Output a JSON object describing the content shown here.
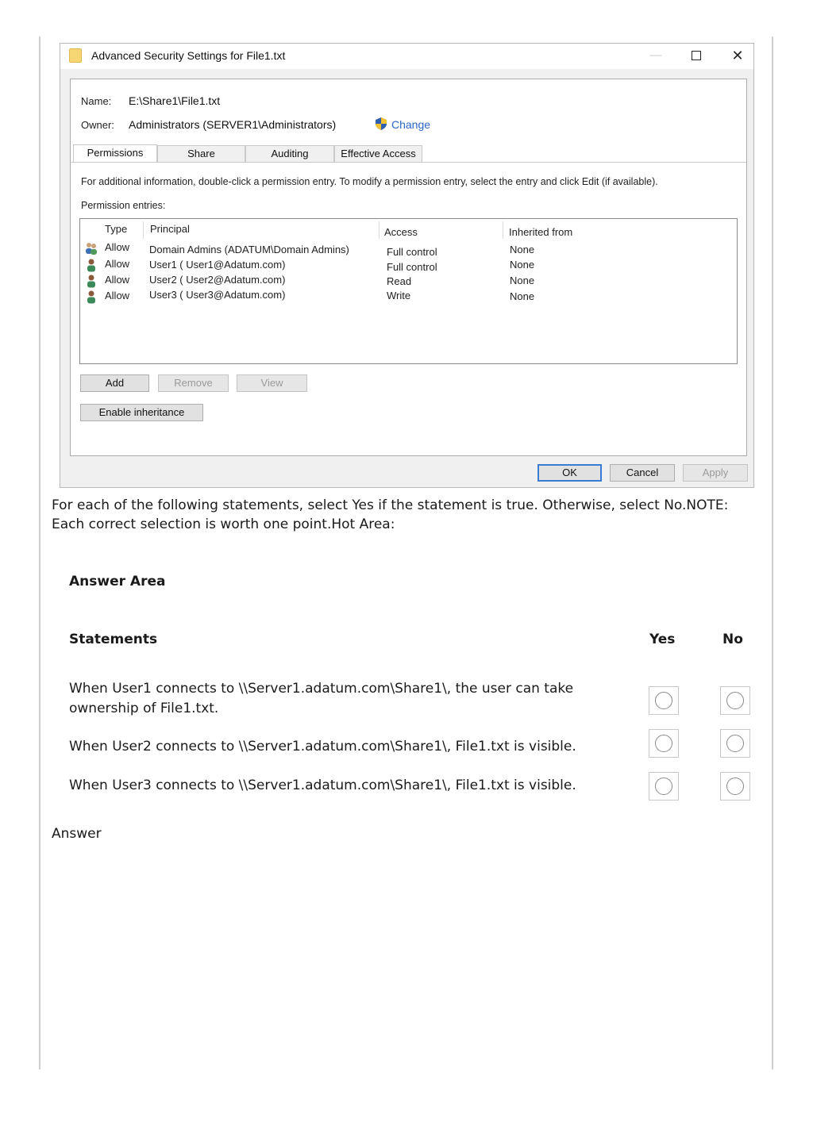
{
  "dialog": {
    "title": "Advanced Security Settings for File1.txt",
    "window_controls": {
      "minimize": "—",
      "close": "✕"
    },
    "name_label": "Name:",
    "name_value": "E:\\Share1\\File1.txt",
    "owner_label": "Owner:",
    "owner_value": "Administrators (SERVER1\\Administrators)",
    "change_link": "Change",
    "tabs": [
      {
        "label": "Permissions",
        "active": true
      },
      {
        "label": "Share",
        "active": false
      },
      {
        "label": "Auditing",
        "active": false
      },
      {
        "label": "Effective Access",
        "active": false
      }
    ],
    "info_text": "For additional information, double-click a permission entry. To modify a permission entry, select the entry and click Edit (if available).",
    "permission_entries_label": "Permission entries:",
    "columns": [
      "Type",
      "Principal",
      "Access",
      "Inherited from"
    ],
    "entries": [
      {
        "type": "Allow",
        "principal": "Domain Admins (ADATUM\\Domain Admins)",
        "access": "Full control",
        "inherited": "None",
        "icon": "group-icon"
      },
      {
        "type": "Allow",
        "principal": "User1 ( User1@Adatum.com)",
        "access": "Full control",
        "inherited": "None",
        "icon": "user-icon"
      },
      {
        "type": "Allow",
        "principal": "User2 ( User2@Adatum.com)",
        "access": "Read",
        "inherited": "None",
        "icon": "user-icon"
      },
      {
        "type": "Allow",
        "principal": "User3 ( User3@Adatum.com)",
        "access": "Write",
        "inherited": "None",
        "icon": "user-icon"
      }
    ],
    "buttons": {
      "add": "Add",
      "remove": "Remove",
      "view": "View",
      "enable_inheritance": "Enable inheritance",
      "ok": "OK",
      "cancel": "Cancel",
      "apply": "Apply"
    },
    "colors": {
      "link": "#2a66c9",
      "accent_border": "#3a7bd5"
    }
  },
  "question": {
    "text": "For each of the following statements, select Yes if the statement is true. Otherwise, select No.NOTE: Each correct selection is worth one point.Hot Area:"
  },
  "answer_area": {
    "title": "Answer Area",
    "statements_header": "Statements",
    "yes_header": "Yes",
    "no_header": "No",
    "statements": [
      "When User1 connects to \\\\Server1.adatum.com\\Share1\\, the user can take ownership of File1.txt.",
      "When User2 connects to \\\\Server1.adatum.com\\Share1\\, File1.txt is visible.",
      "When User3 connects to \\\\Server1.adatum.com\\Share1\\, File1.txt is visible."
    ]
  },
  "answer_label": "Answer"
}
